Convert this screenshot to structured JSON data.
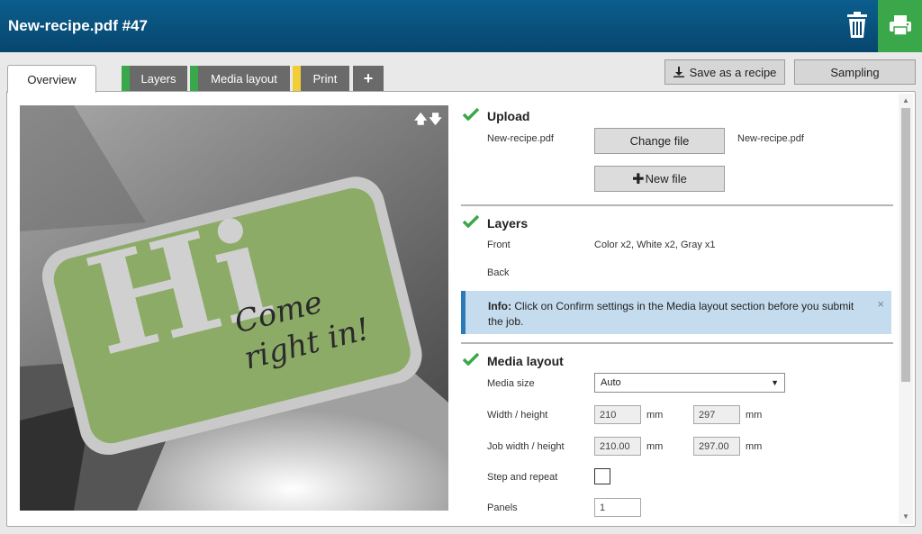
{
  "header": {
    "title": "New-recipe.pdf #47"
  },
  "icons": {
    "trash": "trash-icon",
    "print": "printer-icon",
    "download": "download-icon",
    "plus": "plus-icon",
    "check": "checkmark-icon"
  },
  "colors": {
    "header": "#07466d",
    "print_button": "#3aa84a",
    "tab_green": "#3aa84a",
    "tab_yellow": "#f3cd35",
    "check_green": "#3aa84a",
    "info_border": "#2a7ab8"
  },
  "tabs": [
    {
      "label": "Overview"
    },
    {
      "label": "Layers"
    },
    {
      "label": "Media layout"
    },
    {
      "label": "Print"
    },
    {
      "label": "+"
    }
  ],
  "toolbar": {
    "save_recipe": "Save as a recipe",
    "sampling": "Sampling"
  },
  "preview": {
    "arrows": "🡅🡇",
    "big_text": "Hi",
    "script_line1": "Come",
    "script_line2": "right in!"
  },
  "upload": {
    "title": "Upload",
    "filename": "New-recipe.pdf",
    "change_file": "Change file",
    "current_file": "New-recipe.pdf",
    "new_file": "New file"
  },
  "layers": {
    "title": "Layers",
    "front_label": "Front",
    "front_value": "Color x2, White x2, Gray x1",
    "back_label": "Back"
  },
  "info": {
    "prefix": "Info:",
    "message": "Click on Confirm settings in the Media layout section before you submit the job.",
    "close": "×"
  },
  "media": {
    "title": "Media layout",
    "size_label": "Media size",
    "size_value": "Auto",
    "wh_label": "Width / height",
    "width": "210",
    "height": "297",
    "unit": "mm",
    "job_label": "Job width / height",
    "job_width": "210.00",
    "job_height": "297.00",
    "step_label": "Step and repeat",
    "panels_label": "Panels",
    "panels_value": "1"
  }
}
